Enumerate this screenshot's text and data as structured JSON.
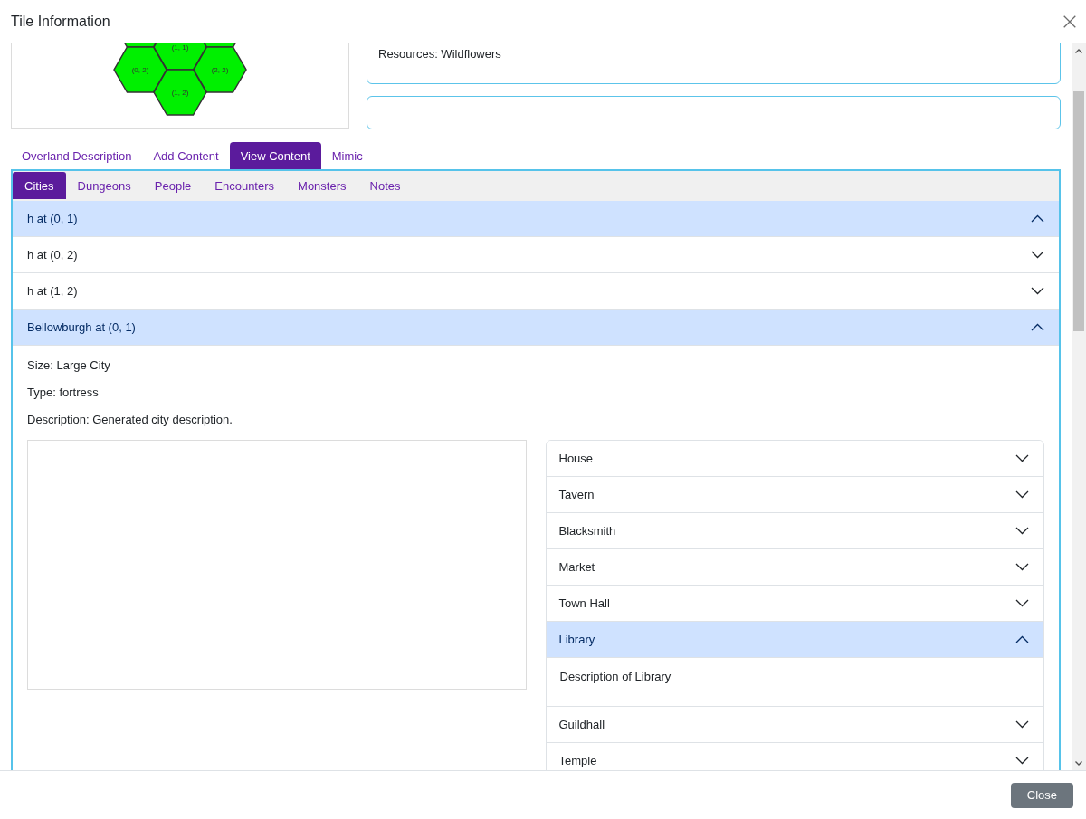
{
  "dialog": {
    "title": "Tile Information"
  },
  "hex_map": {
    "tiles": [
      {
        "label": "(1, 1)"
      },
      {
        "label": "(0, 2)"
      },
      {
        "label": "(2, 2)"
      },
      {
        "label": "(1, 2)"
      }
    ]
  },
  "info_box": {
    "lines": [
      "Resources: Wildflowers"
    ]
  },
  "tabs": [
    {
      "label": "Overland Description",
      "selected": false
    },
    {
      "label": "Add Content",
      "selected": false
    },
    {
      "label": "View Content",
      "selected": true
    },
    {
      "label": "Mimic",
      "selected": false
    }
  ],
  "subtabs": [
    {
      "label": "Cities",
      "selected": true
    },
    {
      "label": "Dungeons",
      "selected": false
    },
    {
      "label": "People",
      "selected": false
    },
    {
      "label": "Encounters",
      "selected": false
    },
    {
      "label": "Monsters",
      "selected": false
    },
    {
      "label": "Notes",
      "selected": false
    }
  ],
  "cities": [
    {
      "title": "h at (0, 1)",
      "expanded": true
    },
    {
      "title": "h at (0, 2)",
      "expanded": false
    },
    {
      "title": "h at (1, 2)",
      "expanded": false
    },
    {
      "title": "Bellowburgh at (0, 1)",
      "expanded": true,
      "details": [
        "Size: Large City",
        "Type: fortress",
        "Description: Generated city description."
      ],
      "buildings": [
        {
          "name": "House",
          "expanded": false
        },
        {
          "name": "Tavern",
          "expanded": false
        },
        {
          "name": "Blacksmith",
          "expanded": false
        },
        {
          "name": "Market",
          "expanded": false
        },
        {
          "name": "Town Hall",
          "expanded": false
        },
        {
          "name": "Library",
          "expanded": true,
          "description": "Description of Library"
        },
        {
          "name": "Guildhall",
          "expanded": false
        },
        {
          "name": "Temple",
          "expanded": false
        }
      ]
    }
  ],
  "footer": {
    "buttons": [
      "Close"
    ]
  }
}
